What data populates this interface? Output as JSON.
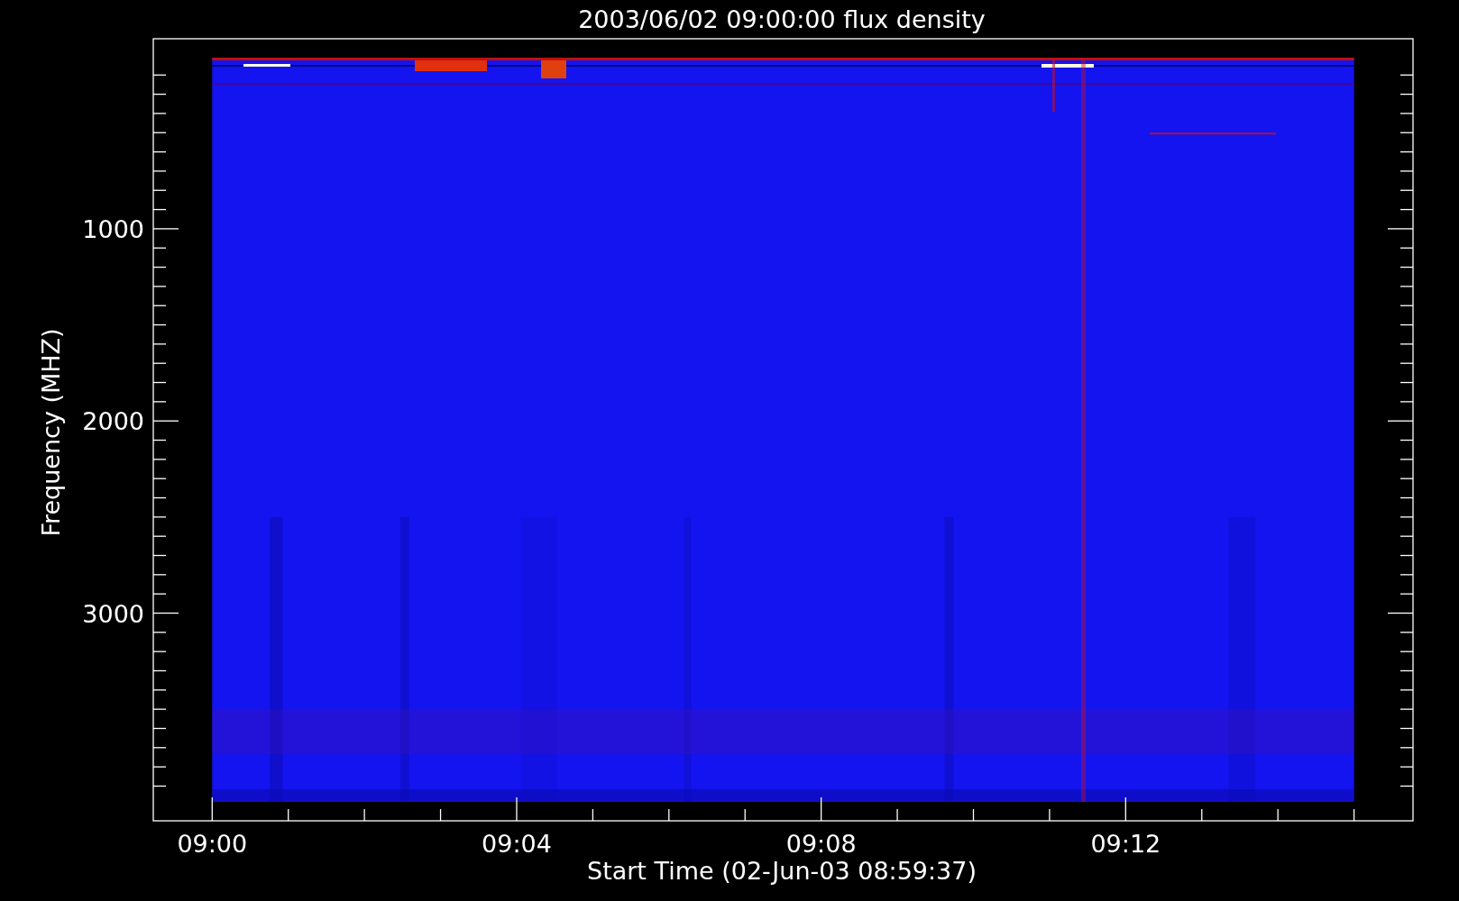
{
  "title": "2003/06/02 09:00:00 flux density",
  "plot": {
    "xlabel": "Start Time (02-Jun-03 08:59:37)",
    "ylabel": "Frequency (MHZ)",
    "xtick_labels": [
      "09:00",
      "09:04",
      "09:08",
      "09:12"
    ],
    "ytick_labels": [
      "1000",
      "2000",
      "3000"
    ]
  }
}
